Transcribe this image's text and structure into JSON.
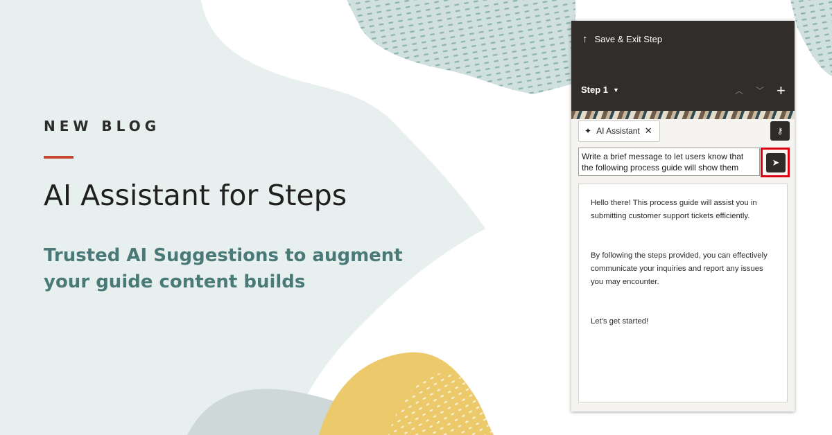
{
  "blog": {
    "eyebrow": "NEW BLOG",
    "headline": "AI Assistant for Steps",
    "subhead": "Trusted AI Suggestions to augment your guide content builds",
    "accent_color": "#c74634",
    "subhead_color": "#4a7a78"
  },
  "panel": {
    "save_exit_label": "Save & Exit Step",
    "step_select_label": "Step 1",
    "chip_label": "AI Assistant",
    "prompt_text": "Write a brief message to let users know that the following process guide will show them",
    "response": {
      "p1": "Hello there! This process guide will assist you in submitting customer support tickets efficiently.",
      "p2": "By following the steps provided, you can effectively communicate your inquiries and report any issues you may encounter.",
      "p3": "Let's get started!"
    },
    "icons": {
      "save_exit": "arrow-up-icon",
      "step_caret": "caret-down-icon",
      "move_up": "chevron-up-icon",
      "move_down": "chevron-down-icon",
      "add": "plus-icon",
      "ai": "magic-wand-icon",
      "remove": "close-icon",
      "key": "key-icon",
      "send": "send-icon"
    },
    "highlight_color": "#e00012"
  }
}
